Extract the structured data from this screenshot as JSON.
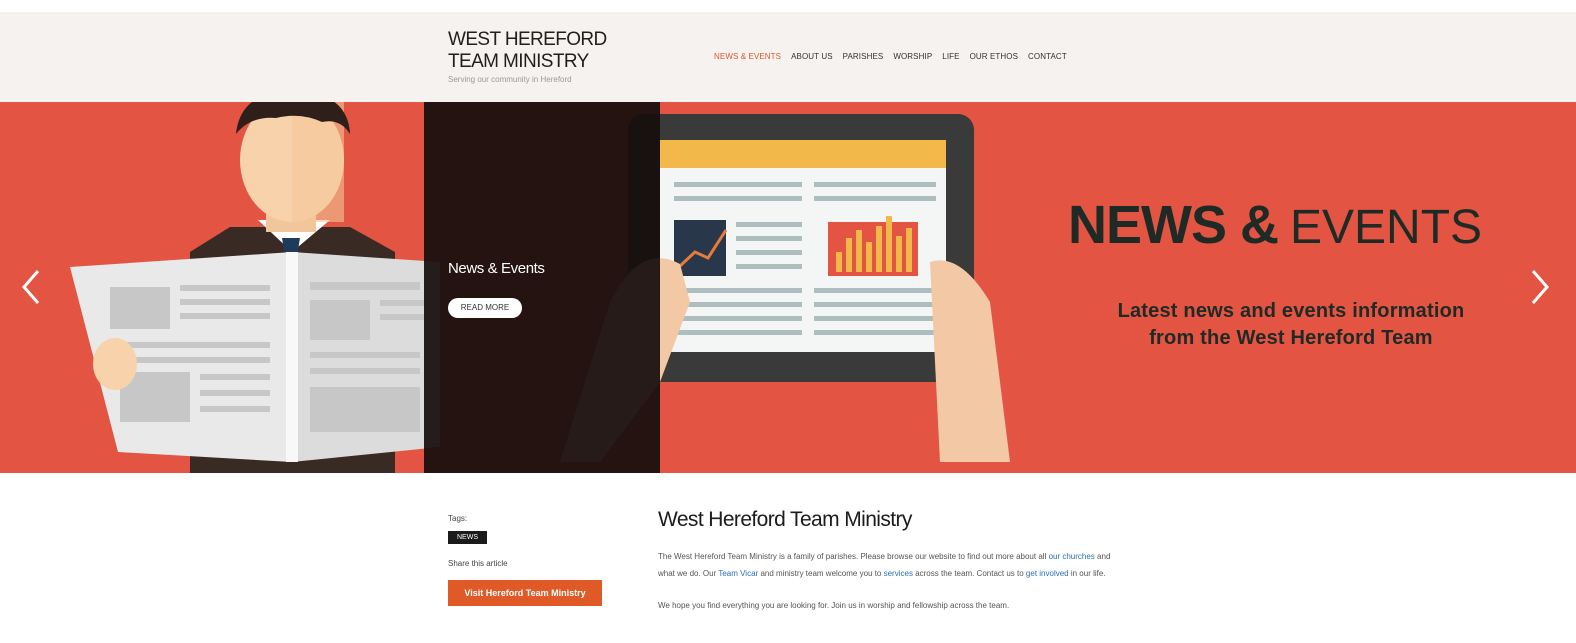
{
  "header": {
    "logo_line1": "WEST HEREFORD",
    "logo_line2": "TEAM MINISTRY",
    "logo_tagline": "Serving our community in Hereford",
    "nav": [
      {
        "label": "NEWS & EVENTS",
        "active": true
      },
      {
        "label": "ABOUT US"
      },
      {
        "label": "PARISHES"
      },
      {
        "label": "WORSHIP"
      },
      {
        "label": "LIFE"
      },
      {
        "label": "OUR ETHOS"
      },
      {
        "label": "CONTACT"
      }
    ]
  },
  "hero": {
    "caption_title": "News & Events",
    "caption_button": "READ MORE",
    "headline_bold": "NEWS &",
    "headline_light": "EVENTS",
    "subline_1": "Latest news and events information",
    "subline_2": "from the West Hereford Team",
    "colors": {
      "accent": "#e35442",
      "panel": "#160e0d",
      "ink": "#1e2a26"
    },
    "icons": [
      "chevron-left-icon",
      "chevron-right-icon"
    ]
  },
  "sidebar": {
    "small_label": "Tags:",
    "tag": "NEWS",
    "small_label2": "Share this article",
    "cta": "Visit Hereford Team Ministry"
  },
  "main": {
    "title": "West Hereford Team Ministry",
    "para1_a": "The West Hereford Team Ministry is a family of parishes. Please browse our website to find out more about all",
    "para1_link1": "our churches",
    "para1_b": "and what we do. Our",
    "para1_link2": "Team Vicar",
    "para1_c": "and ministry team welcome you to",
    "para1_link3": "services",
    "para1_d": "across the team. Contact us to",
    "para1_link4": "get involved",
    "para1_e": "in our life.",
    "para2": "We hope you find everything you are looking for. Join us in worship and fellowship across the team."
  }
}
